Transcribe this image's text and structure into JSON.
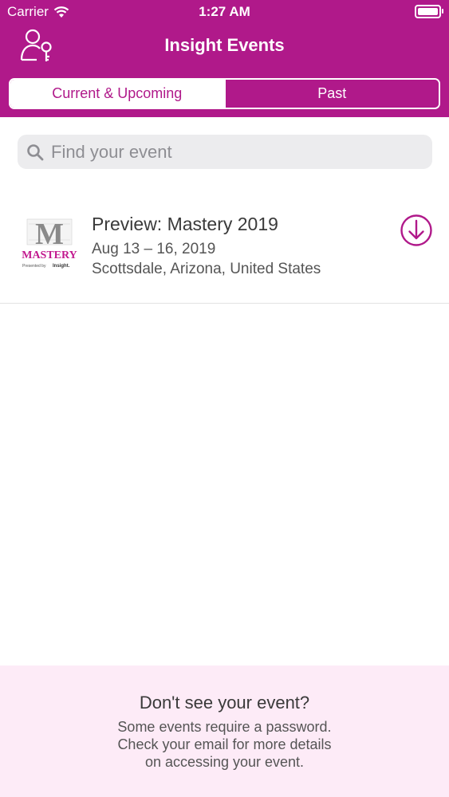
{
  "status_bar": {
    "carrier": "Carrier",
    "time": "1:27 AM"
  },
  "header": {
    "title": "Insight Events",
    "accent_color": "#b0198a"
  },
  "tabs": [
    {
      "label": "Current & Upcoming",
      "active": true
    },
    {
      "label": "Past",
      "active": false
    }
  ],
  "search": {
    "placeholder": "Find your event",
    "value": ""
  },
  "events": [
    {
      "title": "Preview: Mastery 2019",
      "dates": "Aug 13 – 16, 2019",
      "location": "Scottsdale, Arizona, United States",
      "logo": {
        "letter": "M",
        "word": "MASTERY",
        "tagline": "Presented by",
        "brand": "Insight."
      },
      "action_icon": "download-icon"
    }
  ],
  "footer": {
    "title": "Don't see your event?",
    "lines": [
      "Some events require a password.",
      "Check your email for more details",
      "on accessing your event."
    ]
  }
}
